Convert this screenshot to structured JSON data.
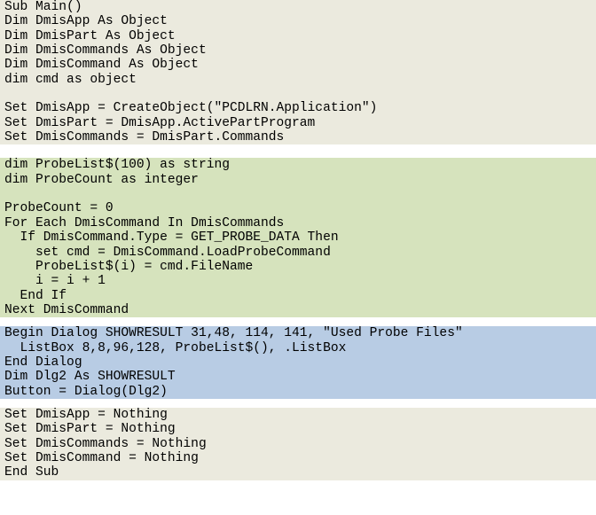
{
  "document": {
    "title": "PC-DMIS Basic script listing",
    "language": "Basic",
    "colors": {
      "page_background": "#ffffff",
      "text": "#000000",
      "highlight_beige": "#ebeade",
      "highlight_green": "#d6e3bd",
      "highlight_blue": "#b8cce4"
    }
  },
  "blocks": [
    {
      "name": "declaration-and-connection-block",
      "highlight": "#ebeade",
      "lines": [
        "Sub Main()",
        "Dim DmisApp As Object",
        "Dim DmisPart As Object",
        "Dim DmisCommands As Object",
        "Dim DmisCommand As Object",
        "dim cmd as object",
        "",
        "Set DmisApp = CreateObject(\"PCDLRN.Application\")",
        "Set DmisPart = DmisApp.ActivePartProgram",
        "Set DmisCommands = DmisPart.Commands"
      ]
    },
    {
      "name": "gap-after-declaration-block",
      "highlight": "#ffffff",
      "height": 15
    },
    {
      "name": "probe-collection-loop-block",
      "highlight": "#d6e3bd",
      "lines": [
        "dim ProbeList$(100) as string",
        "dim ProbeCount as integer",
        "",
        "ProbeCount = 0",
        "For Each DmisCommand In DmisCommands",
        "  If DmisCommand.Type = GET_PROBE_DATA Then",
        "    set cmd = DmisCommand.LoadProbeCommand",
        "    ProbeList$(i) = cmd.FileName",
        "    i = i + 1",
        "  End If",
        "Next DmisCommand"
      ]
    },
    {
      "name": "gap-after-loop-block",
      "highlight": "#ffffff",
      "height": 10
    },
    {
      "name": "dialog-definition-block",
      "highlight": "#b8cce4",
      "lines": [
        "Begin Dialog SHOWRESULT 31,48, 114, 141, \"Used Probe Files\"",
        "  ListBox 8,8,96,128, ProbeList$(), .ListBox",
        "End Dialog",
        "Dim Dlg2 As SHOWRESULT",
        "Button = Dialog(Dlg2)"
      ]
    },
    {
      "name": "gap-after-dialog-block",
      "highlight": "#ffffff",
      "height": 10
    },
    {
      "name": "cleanup-block",
      "highlight": "#ebeade",
      "lines": [
        "Set DmisApp = Nothing",
        "Set DmisPart = Nothing",
        "Set DmisCommands = Nothing",
        "Set DmisCommand = Nothing",
        "End Sub"
      ]
    }
  ]
}
